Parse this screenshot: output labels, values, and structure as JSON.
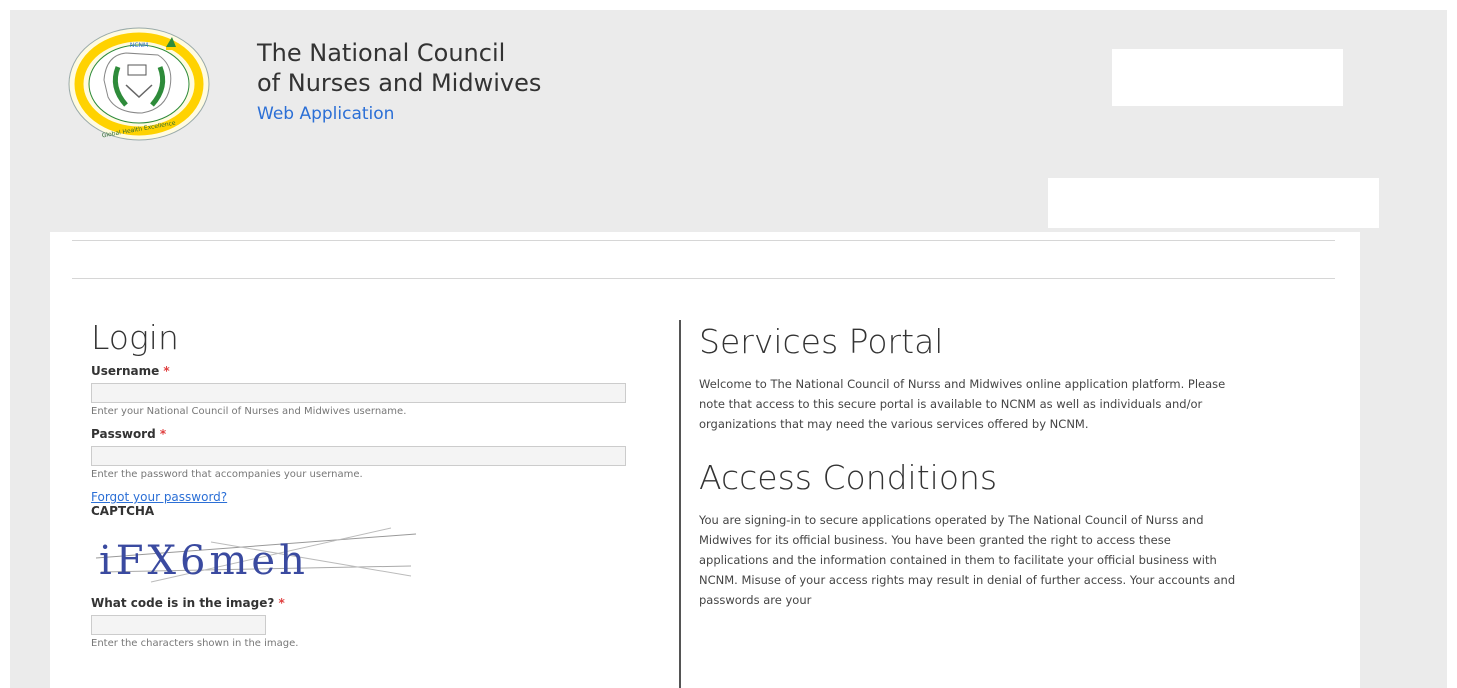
{
  "header": {
    "title_line1": "The National Council",
    "title_line2": "of Nurses and Midwives",
    "slogan": "Web Application",
    "logo": {
      "acronym": "NCNM",
      "motto": "Global Health Excellence",
      "colors": {
        "ring": "#2e8b3a",
        "outer": "#ffd200",
        "mark": "#b5353a"
      }
    }
  },
  "login": {
    "title": "Login",
    "username": {
      "label": "Username",
      "required": "*",
      "value": "",
      "description": "Enter your National Council of Nurses and Midwives username."
    },
    "password": {
      "label": "Password",
      "required": "*",
      "value": "",
      "description": "Enter the password that accompanies your username."
    },
    "forgot_link": "Forgot your password?",
    "captcha": {
      "label": "CAPTCHA",
      "image_text": "iFX6meh",
      "question": "What code is in the image?",
      "required": "*",
      "value": "",
      "description": "Enter the characters shown in the image."
    }
  },
  "info": {
    "services_title": "Services Portal",
    "services_text": "Welcome to The National Council of Nurss and Midwives online application platform. Please note that access to this secure portal is available to NCNM as well as individuals and/or organizations that may need the various services offered by NCNM.",
    "access_title": "Access Conditions",
    "access_text": "You are signing-in to secure applications operated by The National Council of Nurss and Midwives for its official business. You have been granted the right to access these applications and the information contained in them to facilitate your official business with NCNM. Misuse of your access rights may result in denial of further access. Your accounts and passwords are your"
  },
  "colors": {
    "link": "#2b6fd6",
    "required": "#e04040",
    "page_bg": "#ebebeb"
  }
}
